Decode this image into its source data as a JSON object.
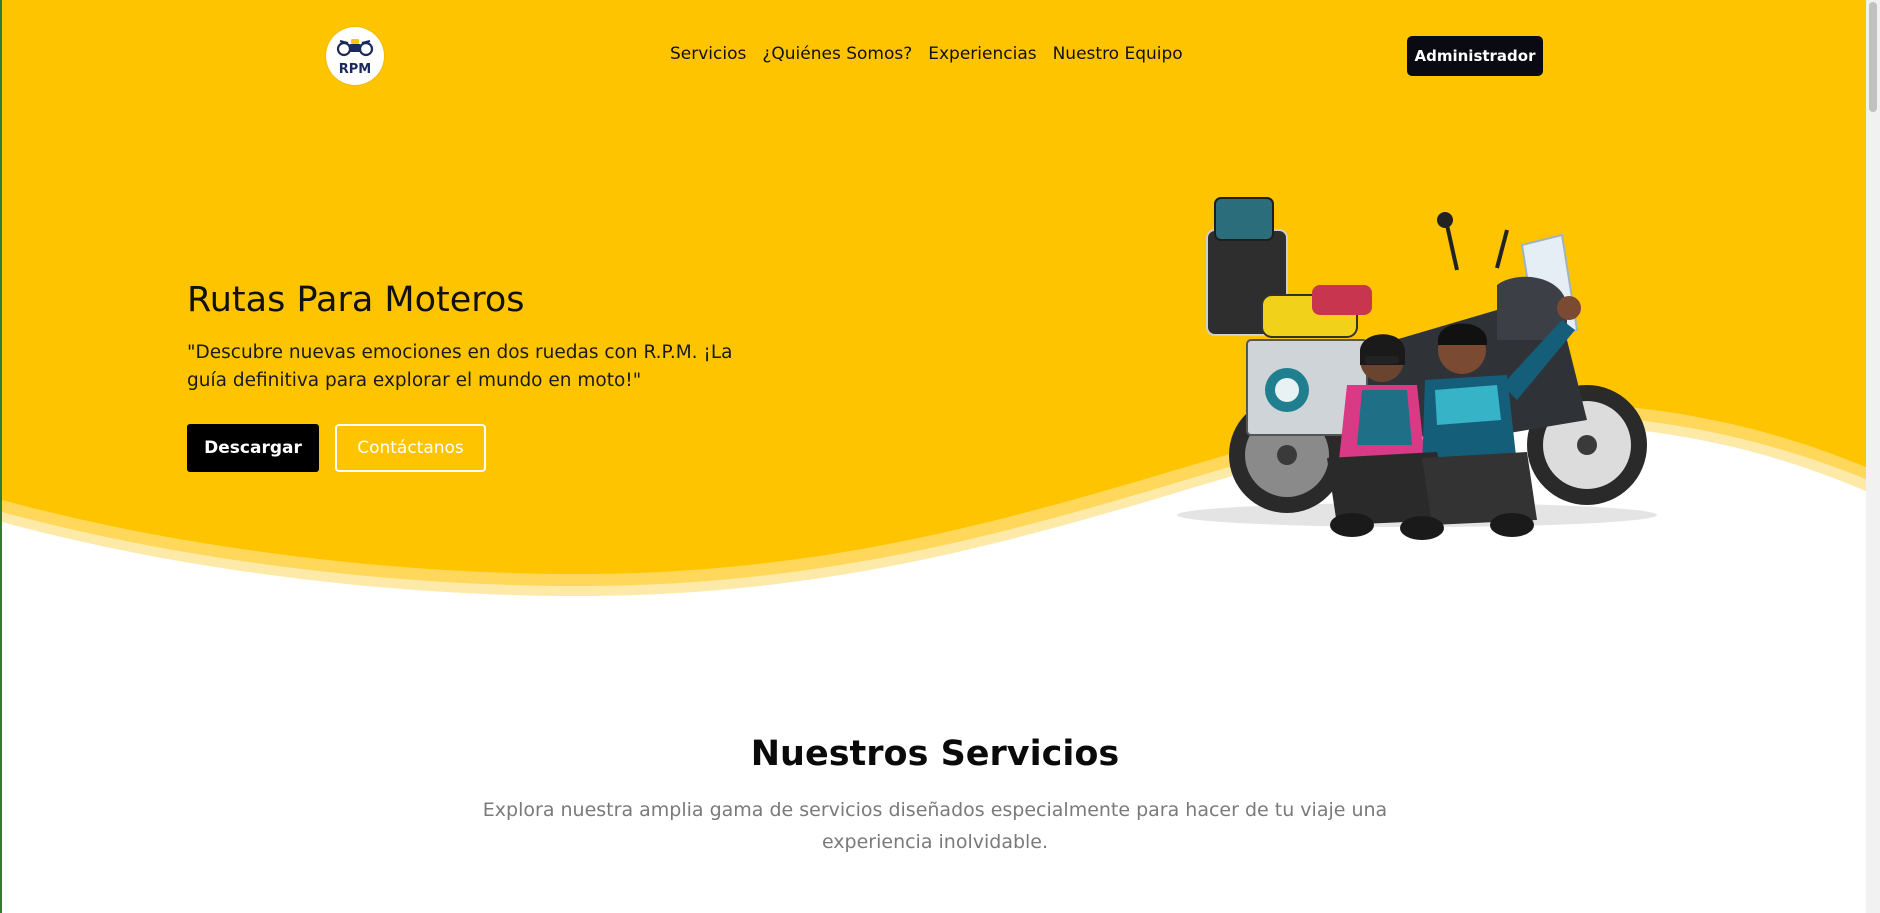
{
  "brand": {
    "logo_text": "RPM",
    "primary_color": "#FFC400",
    "accent_dark": "#0A0A12"
  },
  "nav": {
    "items": [
      "Servicios",
      "¿Quiénes Somos?",
      "Experiencias",
      "Nuestro Equipo"
    ],
    "admin_label": "Administrador"
  },
  "hero": {
    "title": "Rutas Para Moteros",
    "quote": "\"Descubre nuevas emociones en dos ruedas con R.P.M. ¡La guía definitiva para explorar el mundo en moto!\"",
    "download_label": "Descargar",
    "contact_label": "Contáctanos"
  },
  "services": {
    "title": "Nuestros Servicios",
    "subtitle": "Explora nuestra amplia gama de servicios diseñados especialmente para hacer de tu viaje una experiencia inolvidable."
  }
}
